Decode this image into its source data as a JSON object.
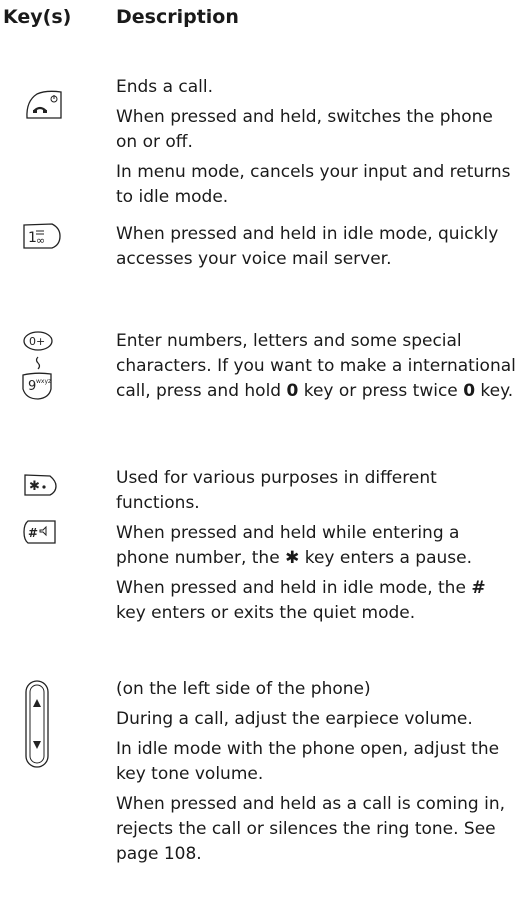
{
  "header": {
    "keys_label": "Key(s)",
    "description_label": "Description"
  },
  "rows": [
    {
      "icons": [
        "end-key-icon"
      ],
      "paragraphs": [
        "Ends a call.",
        "When pressed and held, switches the phone on or off.",
        "In menu mode, cancels your input and returns to idle mode."
      ]
    },
    {
      "icons": [
        "voicemail-key-icon"
      ],
      "paragraphs": [
        "When pressed and held in idle mode, quickly accesses your voice mail server."
      ]
    },
    {
      "icons": [
        "zero-key-icon",
        "tilde-icon",
        "nine-key-icon"
      ],
      "p1": "Enter numbers, letters and some special characters. If you want to make a international call, press and hold ",
      "bold1": "0",
      "p2": " key or press twice ",
      "bold2": "0",
      "p3": " key."
    },
    {
      "icons": [
        "star-key-icon",
        "hash-key-icon"
      ],
      "paragraphs": [
        "Used for various purposes in different functions."
      ],
      "star_a": "When pressed and held while entering a phone number, the ",
      "star_sym": "✱",
      "star_b": " key enters a pause.",
      "hash_a": "When pressed and held in idle mode, the ",
      "hash_sym": "#",
      "hash_b": " key enters or exits the quiet mode."
    },
    {
      "icons": [
        "volume-key-icon"
      ],
      "paragraphs": [
        "(on the left side of the phone)",
        "During a call, adjust the earpiece volume.",
        "In idle mode with the phone open, adjust the key tone volume.",
        "When pressed and held as a call is coming in, rejects the call or silences the ring tone. See page 108."
      ]
    }
  ]
}
